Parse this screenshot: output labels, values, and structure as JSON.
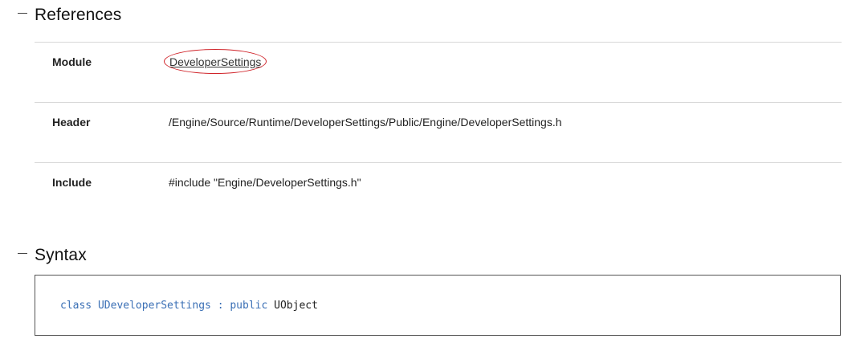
{
  "references": {
    "heading": "References",
    "rows": [
      {
        "key": "Module",
        "value": "DeveloperSettings"
      },
      {
        "key": "Header",
        "value": "/Engine/Source/Runtime/DeveloperSettings/Public/Engine/DeveloperSettings.h"
      },
      {
        "key": "Include",
        "value": "#include \"Engine/DeveloperSettings.h\""
      }
    ]
  },
  "syntax": {
    "heading": "Syntax",
    "code": {
      "kw_class": "class",
      "class_name": "UDeveloperSettings",
      "colon": ":",
      "kw_public": "public",
      "base_class": "UObject"
    }
  },
  "colors": {
    "keyword": "#3a6fb5",
    "highlight_ring": "#d0242a"
  }
}
